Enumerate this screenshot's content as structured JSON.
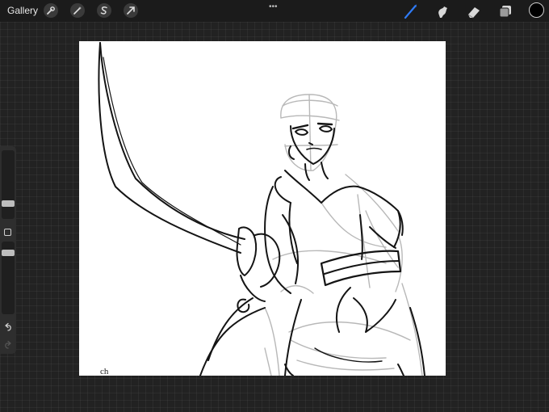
{
  "topbar": {
    "gallery_label": "Gallery",
    "left_tools": [
      "wrench-icon",
      "magic-wand-icon",
      "selection-s-icon",
      "transform-arrow-icon"
    ],
    "more_dots": "•••",
    "right_tools": [
      "brush-icon",
      "smudge-icon",
      "eraser-icon",
      "layers-icon"
    ],
    "current_color": "#000000",
    "brush_accent": "#2f7bf6"
  },
  "sidebar": {
    "brush_size_level": 0.2,
    "opacity_level": 0.5,
    "icons": [
      "modify-square-icon",
      "undo-icon",
      "redo-icon"
    ]
  },
  "canvas": {
    "signature": "ch"
  }
}
